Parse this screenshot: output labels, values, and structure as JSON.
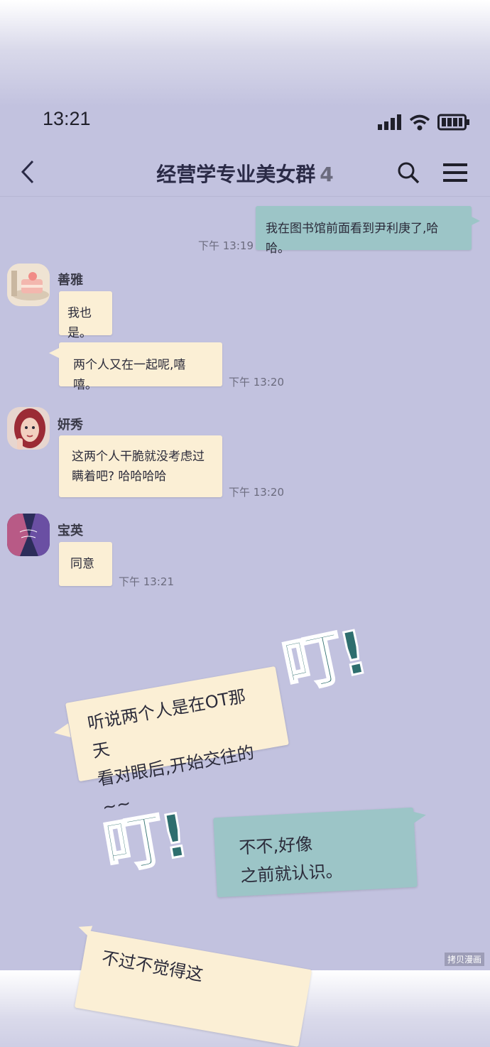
{
  "status_bar": {
    "time": "13:21"
  },
  "header": {
    "title": "经营学专业美女群",
    "member_count": "4"
  },
  "messages": {
    "me": {
      "text": "我在图书馆前面看到尹利庚了,哈哈。",
      "time": "下午 13:19"
    },
    "shanya": {
      "name": "善雅",
      "msg1": "我也是。",
      "msg2": "两个人又在一起呢,嘻嘻。",
      "time": "下午 13:20"
    },
    "yanxiu": {
      "name": "妍秀",
      "line1": "这两个人干脆就没考虑过",
      "line2": "瞒着吧? 哈哈哈哈",
      "time": "下午 13:20"
    },
    "baoying": {
      "name": "宝英",
      "text": "同意",
      "time": "下午 13:21"
    }
  },
  "overlay": {
    "sfx": "叮!",
    "bubble1": {
      "line1": "听说两个人是在OT那天",
      "line2": "看对眼后,开始交往的~~"
    },
    "bubble2": {
      "line1": "不不,好像",
      "line2": "之前就认识。"
    },
    "bubble3": {
      "line1": "不过不觉得这"
    }
  },
  "watermark": "拷贝漫画",
  "colors": {
    "background": "#c2c2df",
    "cream_bubble": "#fbefd5",
    "teal_bubble": "#9cc5c7",
    "sfx": "#2e6e6e"
  }
}
